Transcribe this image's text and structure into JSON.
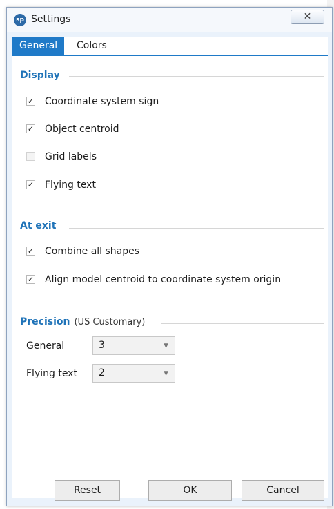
{
  "window": {
    "title": "Settings",
    "app_icon_text": "sp",
    "close_glyph": "✕"
  },
  "tabs": [
    {
      "label": "General",
      "active": true
    },
    {
      "label": "Colors",
      "active": false
    }
  ],
  "display": {
    "header": "Display",
    "options": [
      {
        "label": "Coordinate system sign",
        "checked": true
      },
      {
        "label": "Object centroid",
        "checked": true
      },
      {
        "label": "Grid labels",
        "checked": false
      },
      {
        "label": "Flying text",
        "checked": true
      }
    ]
  },
  "at_exit": {
    "header": "At exit",
    "options": [
      {
        "label": "Combine all shapes",
        "checked": true
      },
      {
        "label": "Align model centroid to coordinate system origin",
        "checked": true
      }
    ]
  },
  "precision": {
    "header": "Precision",
    "units": "(US Customary)",
    "fields": [
      {
        "label": "General",
        "value": "3"
      },
      {
        "label": "Flying text",
        "value": "2"
      }
    ]
  },
  "buttons": {
    "reset": "Reset",
    "ok": "OK",
    "cancel": "Cancel"
  },
  "check_glyph": "✓",
  "dropdown_glyph": "▼",
  "colors": {
    "accent": "#1f7ac8",
    "section_header": "#1f73b8",
    "window_bg": "#eaf2fb"
  }
}
